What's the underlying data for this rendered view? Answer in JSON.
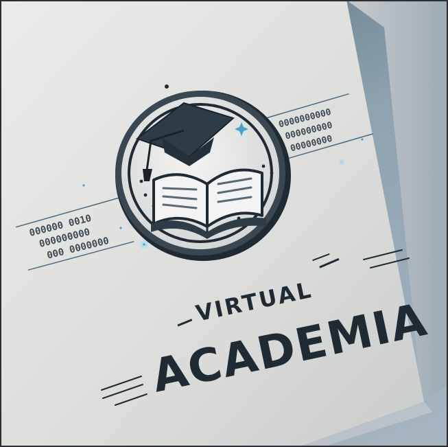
{
  "logo": {
    "line1": "VIRTUAL",
    "line2": "ACADEMIA",
    "binary_left": [
      "000000 0010",
      "000000000",
      "000 0000000"
    ],
    "binary_right": [
      "0000000000",
      "000000000",
      "00000000"
    ]
  },
  "colors": {
    "ink": "#1f2a33",
    "paper": "#dedfdd",
    "accent": "#4aa3c9",
    "cap": "#2e3c48"
  },
  "icons": [
    "graduation-cap-icon",
    "open-book-icon",
    "sparkle-icon"
  ]
}
